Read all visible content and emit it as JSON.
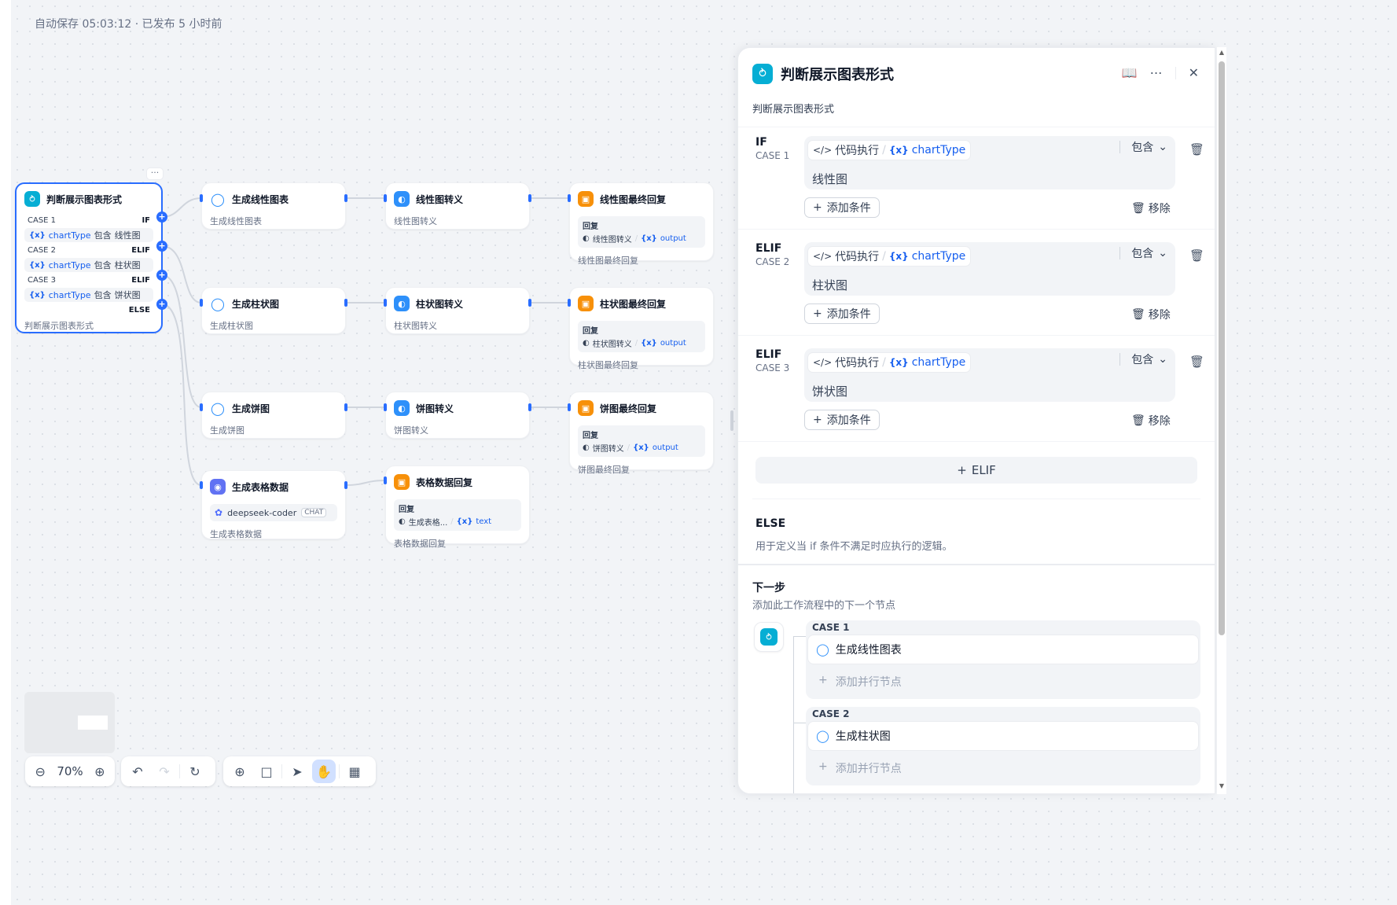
{
  "autosave": "自动保存 05:03:12 · 已发布 5 小时前",
  "ifnode": {
    "title": "判断展示图表形式",
    "desc": "判断展示图表形式",
    "more": "···",
    "cases": [
      {
        "label": "CASE 1",
        "kind": "IF",
        "var": "chartType",
        "op": "包含",
        "value": "线性图"
      },
      {
        "label": "CASE 2",
        "kind": "ELIF",
        "var": "chartType",
        "op": "包含",
        "value": "柱状图"
      },
      {
        "label": "CASE 3",
        "kind": "ELIF",
        "var": "chartType",
        "op": "包含",
        "value": "饼状图"
      }
    ],
    "else": "ELSE"
  },
  "nodes": {
    "gen_line": {
      "title": "生成线性图表",
      "desc": "生成线性图表"
    },
    "gen_bar": {
      "title": "生成柱状图",
      "desc": "生成柱状图"
    },
    "gen_pie": {
      "title": "生成饼图",
      "desc": "生成饼图"
    },
    "gen_table": {
      "title": "生成表格数据",
      "model": "deepseek-coder",
      "tag": "CHAT",
      "desc": "生成表格数据"
    },
    "esc_line": {
      "title": "线性图转义",
      "desc": "线性图转义"
    },
    "esc_bar": {
      "title": "柱状图转义",
      "desc": "柱状图转义"
    },
    "esc_pie": {
      "title": "饼图转义",
      "desc": "饼图转义"
    },
    "reply_table": {
      "title": "表格数据回复",
      "reply_label": "回复",
      "src": "生成表格...",
      "var": "text",
      "desc": "表格数据回复"
    },
    "reply_line": {
      "title": "线性图最终回复",
      "reply_label": "回复",
      "src": "线性图转义",
      "var": "output",
      "desc": "线性图最终回复"
    },
    "reply_bar": {
      "title": "柱状图最终回复",
      "reply_label": "回复",
      "src": "柱状图转义",
      "var": "output",
      "desc": "柱状图最终回复"
    },
    "reply_pie": {
      "title": "饼图最终回复",
      "reply_label": "回复",
      "src": "饼图转义",
      "var": "output",
      "desc": "饼图最终回复"
    }
  },
  "toolbar": {
    "zoom": "70%"
  },
  "panel": {
    "title": "判断展示图表形式",
    "desc": "判断展示图表形式",
    "cases": [
      {
        "kind": "IF",
        "label": "CASE 1",
        "src": "代码执行",
        "var": "chartType",
        "op": "包含",
        "value": "线性图"
      },
      {
        "kind": "ELIF",
        "label": "CASE 2",
        "src": "代码执行",
        "var": "chartType",
        "op": "包含",
        "value": "柱状图"
      },
      {
        "kind": "ELIF",
        "label": "CASE 3",
        "src": "代码执行",
        "var": "chartType",
        "op": "包含",
        "value": "饼状图"
      }
    ],
    "add_condition": "添加条件",
    "remove": "移除",
    "add_elif": "ELIF",
    "else_title": "ELSE",
    "else_desc": "用于定义当 if 条件不满足时应执行的逻辑。",
    "next_title": "下一步",
    "next_desc": "添加此工作流程中的下一个节点",
    "branches": [
      {
        "label": "CASE 1",
        "node": "生成线性图表",
        "add": "添加并行节点"
      },
      {
        "label": "CASE 2",
        "node": "生成柱状图",
        "add": "添加并行节点"
      }
    ]
  },
  "colors": {
    "accent": "#296dff",
    "teal": "#06aed4",
    "orange": "#f79009",
    "blue": "#2e90fa",
    "purple": "#6172f3"
  }
}
